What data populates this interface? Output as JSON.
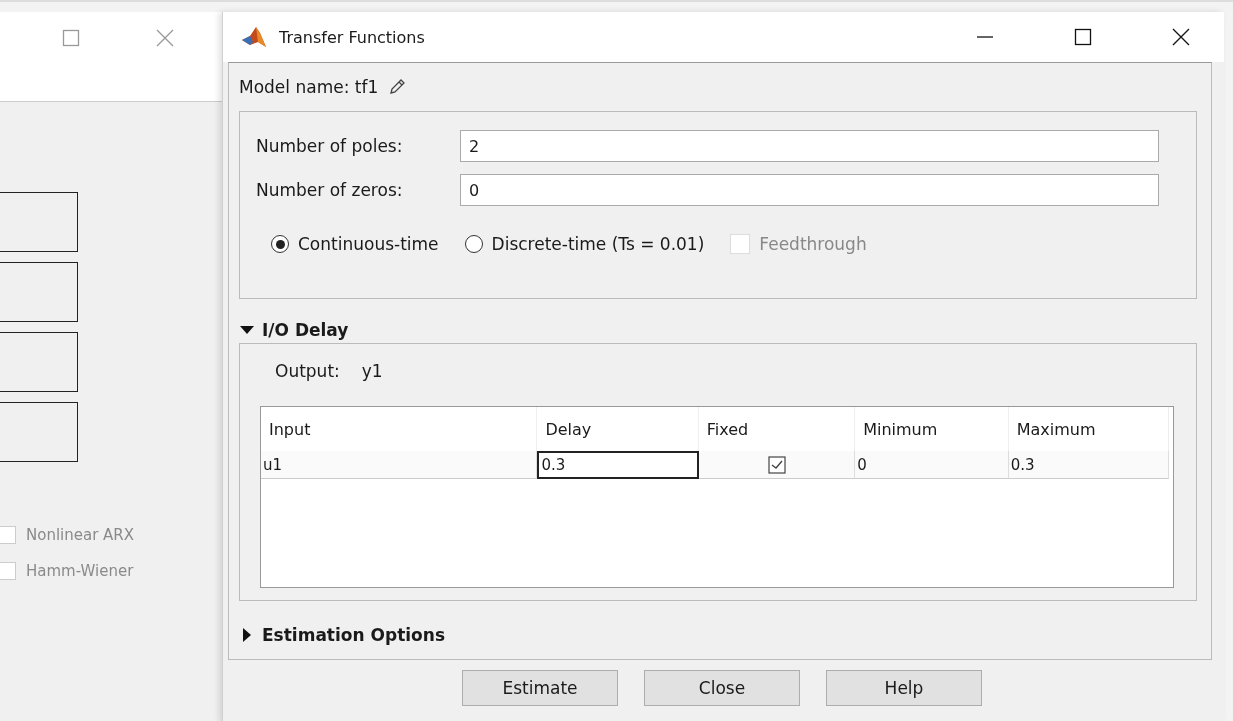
{
  "background_window": {
    "checkboxes": [
      {
        "label": "Nonlinear ARX",
        "checked": false,
        "disabled": true
      },
      {
        "label": "Hamm-Wiener",
        "checked": false,
        "disabled": true
      }
    ]
  },
  "window": {
    "title": "Transfer Functions"
  },
  "model_name": "Model name: tf1",
  "fields": [
    {
      "label": "Number of poles:",
      "value": "2"
    },
    {
      "label": "Number of zeros:",
      "value": "0"
    }
  ],
  "time_domain": [
    {
      "label": "Continuous-time",
      "selected": true
    },
    {
      "label": "Discrete-time (Ts = 0.01)",
      "selected": false
    }
  ],
  "feedthrough": {
    "label": "Feedthrough",
    "checked": false,
    "disabled": true
  },
  "sections": [
    {
      "title": "I/O Delay",
      "expanded": true
    },
    {
      "title": "Estimation Options",
      "expanded": false
    }
  ],
  "io_delay": {
    "output_label": "Output:",
    "output_value": "y1",
    "table": {
      "columns": [
        "Input",
        "Delay",
        "Fixed",
        "Minimum",
        "Maximum"
      ],
      "rows": [
        {
          "input": "u1",
          "delay": "0.3",
          "fixed": true,
          "minimum": "0",
          "maximum": "0.3"
        }
      ]
    }
  },
  "buttons": [
    "Estimate",
    "Close",
    "Help"
  ]
}
